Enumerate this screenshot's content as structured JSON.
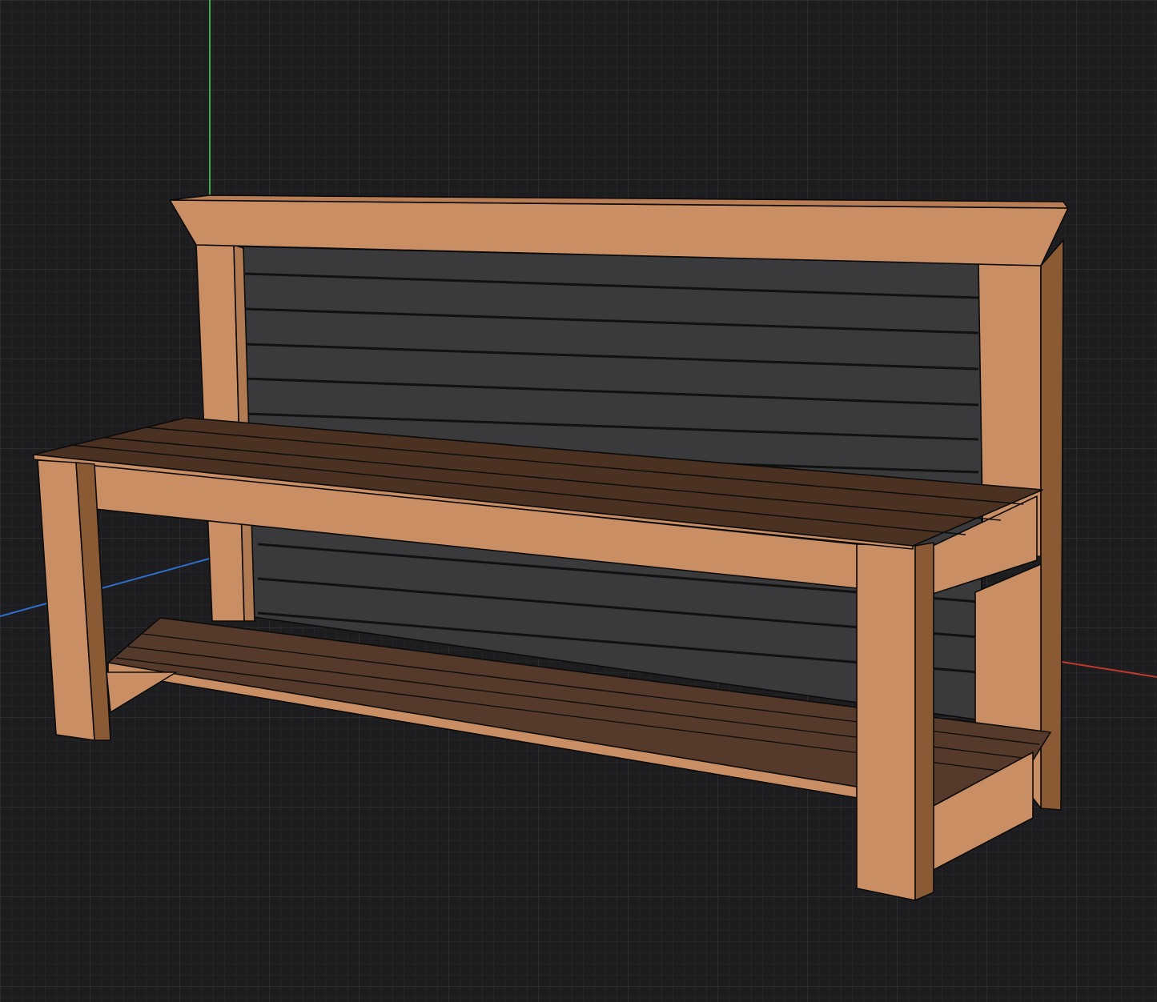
{
  "viewport": {
    "background": "#1d1d1f",
    "grid_minor": "#2a2a2d",
    "grid_major": "#34343a"
  },
  "axes": {
    "x_color": "#c0392b",
    "y_color": "#3fae49",
    "z_color": "#2e6fd1"
  },
  "model": {
    "name": "bench",
    "colors": {
      "frame_light": "#c98e64",
      "frame_mid": "#b97d55",
      "frame_dark": "#8a5a35",
      "slat_dark": "#4a3121",
      "slat_mid": "#55392a",
      "panel": "#3a3a3c",
      "panel_slat": "#404042",
      "edge": "#0b0b0b"
    }
  }
}
